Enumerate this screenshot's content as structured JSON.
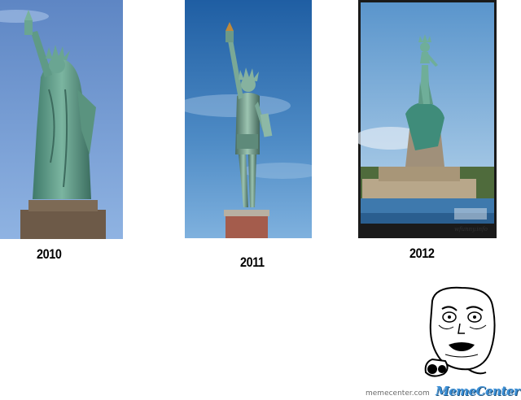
{
  "panels": [
    {
      "year": "2010"
    },
    {
      "year": "2011"
    },
    {
      "year": "2012",
      "credit": "wfunny.info"
    }
  ],
  "footer": {
    "watermark": "memecenter.com",
    "brand": "MemeCenter"
  }
}
